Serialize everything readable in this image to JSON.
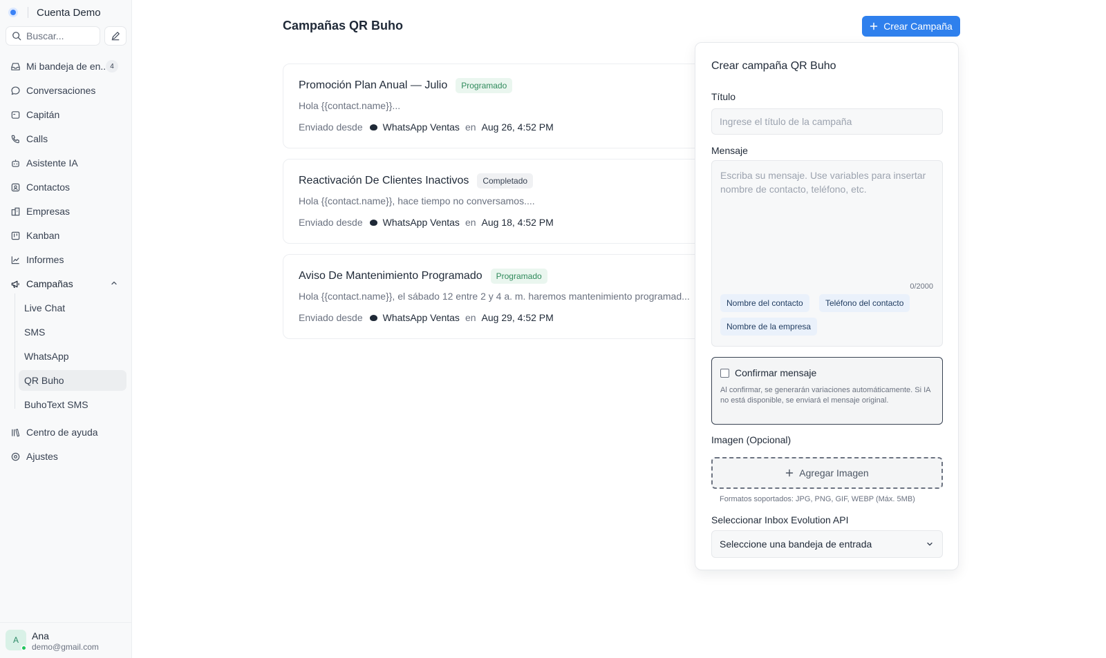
{
  "account": {
    "name": "Cuenta Demo"
  },
  "search": {
    "placeholder": "Buscar..."
  },
  "nav": {
    "inbox": {
      "label": "Mi bandeja de en...",
      "count": "4"
    },
    "conversations": "Conversaciones",
    "captain": "Capitán",
    "calls": "Calls",
    "assistant": "Asistente IA",
    "contacts": "Contactos",
    "companies": "Empresas",
    "kanban": "Kanban",
    "reports": "Informes",
    "campaigns": "Campañas",
    "sub": [
      "Live Chat",
      "SMS",
      "WhatsApp",
      "QR Buho",
      "BuhoText SMS"
    ],
    "help": "Centro de ayuda",
    "settings": "Ajustes"
  },
  "user": {
    "initial": "A",
    "name": "Ana",
    "email": "demo@gmail.com"
  },
  "main": {
    "title": "Campañas QR Buho",
    "create_label": "Crear Campaña"
  },
  "campaigns": [
    {
      "title": "Promoción Plan Anual — Julio",
      "status": "Programado",
      "message": "Hola {{contact.name}}...",
      "sent_from": "Enviado desde",
      "inbox": "WhatsApp Ventas",
      "on": "en",
      "date": "Aug 26, 4:52 PM"
    },
    {
      "title": "Reactivación De Clientes Inactivos",
      "status": "Completado",
      "message": "Hola {{contact.name}}, hace tiempo no conversamos....",
      "sent_from": "Enviado desde",
      "inbox": "WhatsApp Ventas",
      "on": "en",
      "date": "Aug 18, 4:52 PM"
    },
    {
      "title": "Aviso De Mantenimiento Programado",
      "status": "Programado",
      "message": "Hola {{contact.name}}, el sábado 12 entre 2 y 4 a. m. haremos mantenimiento programad...",
      "sent_from": "Enviado desde",
      "inbox": "WhatsApp Ventas",
      "on": "en",
      "date": "Aug 29, 4:52 PM"
    }
  ],
  "form": {
    "heading": "Crear campaña QR Buho",
    "title_label": "Título",
    "title_placeholder": "Ingrese el título de la campaña",
    "message_label": "Mensaje",
    "message_placeholder": "Escriba su mensaje. Use variables para insertar nombre de contacto, teléfono, etc.",
    "counter": "0/2000",
    "variables": [
      "Nombre del contacto",
      "Teléfono del contacto",
      "Nombre de la empresa"
    ],
    "confirm_label": "Confirmar mensaje",
    "confirm_help": "Al confirmar, se generarán variaciones automáticamente. Si IA no está disponible, se enviará el mensaje original.",
    "image_label": "Imagen (Opcional)",
    "add_image": "Agregar Imagen",
    "formats": "Formatos soportados: JPG, PNG, GIF, WEBP (Máx. 5MB)",
    "inbox_label": "Seleccionar Inbox Evolution API",
    "inbox_placeholder": "Seleccione una bandeja de entrada"
  },
  "colors": {
    "primary": "#2f80ed",
    "status_green": "#2f8a5b",
    "sidebar_bg": "#f8f9fa"
  }
}
